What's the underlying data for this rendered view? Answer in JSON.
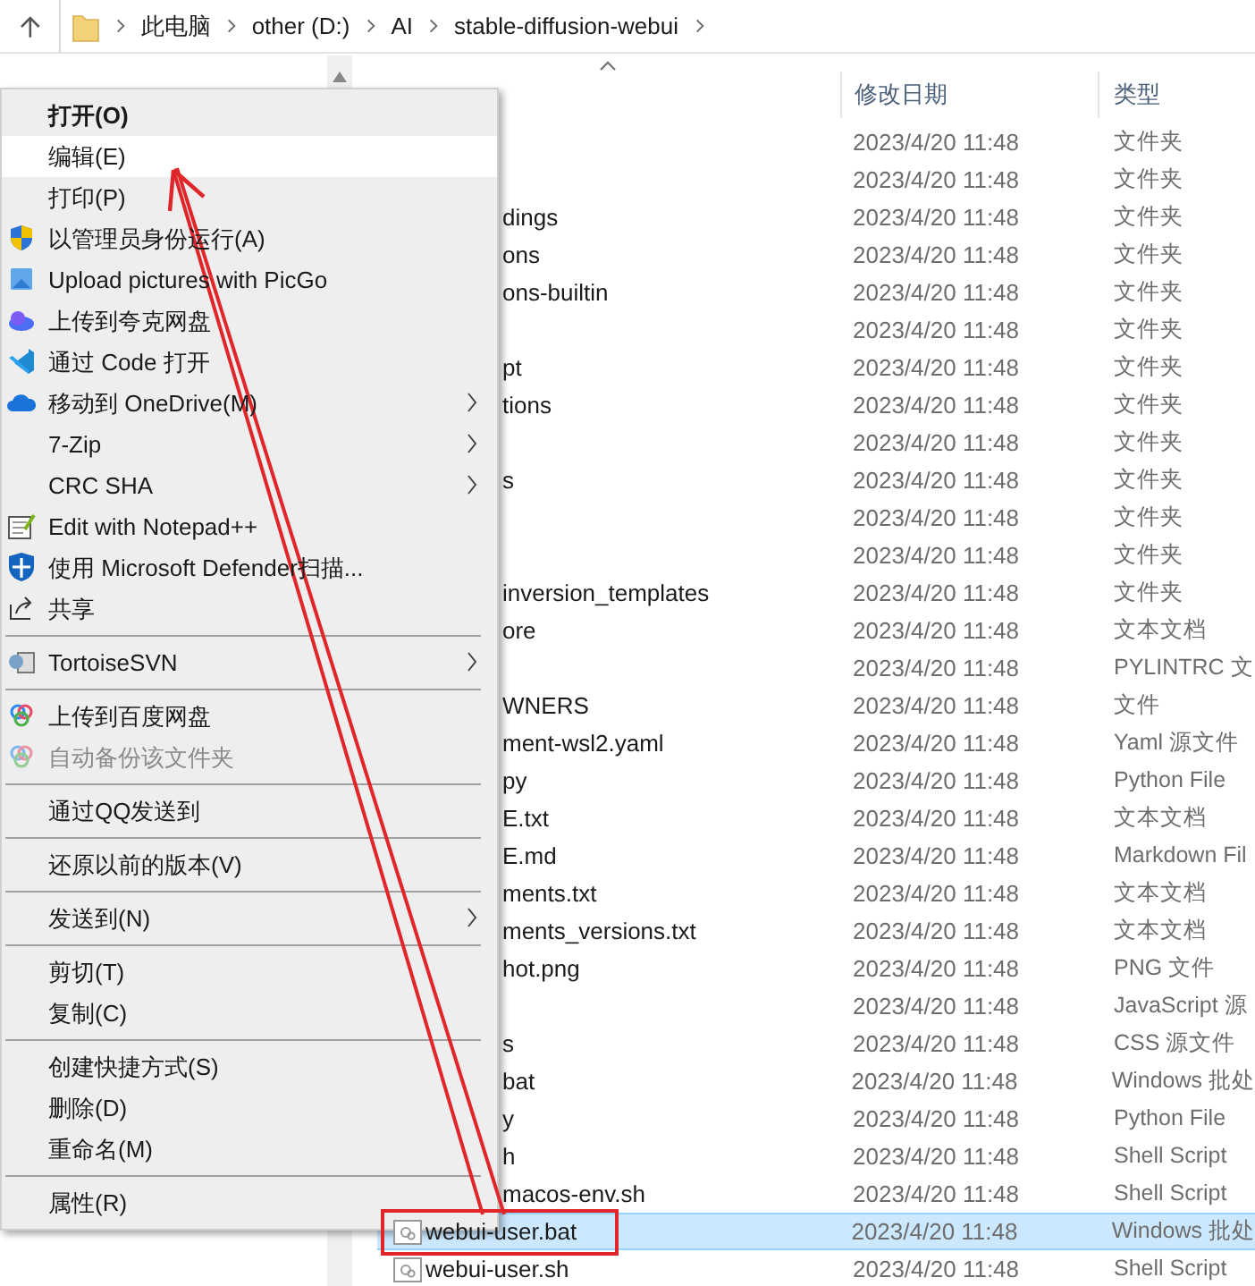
{
  "address_bar": {
    "path": [
      "此电脑",
      "other (D:)",
      "AI",
      "stable-diffusion-webui"
    ]
  },
  "columns": [
    "修改日期",
    "类型"
  ],
  "rows": [
    {
      "date": "2023/4/20 11:48",
      "type": "文件夹",
      "selected": false
    },
    {
      "date": "2023/4/20 11:48",
      "type": "文件夹",
      "selected": false
    },
    {
      "name": "dings",
      "date": "2023/4/20 11:48",
      "type": "文件夹",
      "selected": false
    },
    {
      "name": "ons",
      "date": "2023/4/20 11:48",
      "type": "文件夹",
      "selected": false
    },
    {
      "name": "ons-builtin",
      "date": "2023/4/20 11:48",
      "type": "文件夹",
      "selected": false
    },
    {
      "date": "2023/4/20 11:48",
      "type": "文件夹",
      "selected": false
    },
    {
      "name": "pt",
      "date": "2023/4/20 11:48",
      "type": "文件夹",
      "selected": false
    },
    {
      "name": "tions",
      "date": "2023/4/20 11:48",
      "type": "文件夹",
      "selected": false
    },
    {
      "date": "2023/4/20 11:48",
      "type": "文件夹",
      "selected": false
    },
    {
      "name": "s",
      "date": "2023/4/20 11:48",
      "type": "文件夹",
      "selected": false
    },
    {
      "date": "2023/4/20 11:48",
      "type": "文件夹",
      "selected": false
    },
    {
      "date": "2023/4/20 11:48",
      "type": "文件夹",
      "selected": false
    },
    {
      "name": "inversion_templates",
      "date": "2023/4/20 11:48",
      "type": "文件夹",
      "selected": false
    },
    {
      "name": "ore",
      "date": "2023/4/20 11:48",
      "type": "文本文档",
      "selected": false
    },
    {
      "date": "2023/4/20 11:48",
      "type": "PYLINTRC 文",
      "selected": false
    },
    {
      "name": "WNERS",
      "date": "2023/4/20 11:48",
      "type": "文件",
      "selected": false
    },
    {
      "name": "ment-wsl2.yaml",
      "date": "2023/4/20 11:48",
      "type": "Yaml 源文件",
      "selected": false
    },
    {
      "name": "py",
      "date": "2023/4/20 11:48",
      "type": "Python File",
      "selected": false
    },
    {
      "name": "E.txt",
      "date": "2023/4/20 11:48",
      "type": "文本文档",
      "selected": false
    },
    {
      "name": "E.md",
      "date": "2023/4/20 11:48",
      "type": "Markdown Fil",
      "selected": false
    },
    {
      "name": "ments.txt",
      "date": "2023/4/20 11:48",
      "type": "文本文档",
      "selected": false
    },
    {
      "name": "ments_versions.txt",
      "date": "2023/4/20 11:48",
      "type": "文本文档",
      "selected": false
    },
    {
      "name": "hot.png",
      "date": "2023/4/20 11:48",
      "type": "PNG 文件",
      "selected": false
    },
    {
      "date": "2023/4/20 11:48",
      "type": "JavaScript 源",
      "selected": false
    },
    {
      "name": "s",
      "date": "2023/4/20 11:48",
      "type": "CSS 源文件",
      "selected": false
    },
    {
      "name": "bat",
      "date": "2023/4/20 11:48",
      "type": "Windows 批处",
      "selected": false
    },
    {
      "name": "y",
      "date": "2023/4/20 11:48",
      "type": "Python File",
      "selected": false
    },
    {
      "name": "h",
      "date": "2023/4/20 11:48",
      "type": "Shell Script",
      "selected": false
    },
    {
      "name": "macos-env.sh",
      "date": "2023/4/20 11:48",
      "type": "Shell Script",
      "selected": false
    },
    {
      "name": "webui-user.bat",
      "date": "2023/4/20 11:48",
      "type": "Windows 批处",
      "selected": true,
      "full": true
    },
    {
      "name": "webui-user.sh",
      "date": "2023/4/20 11:48",
      "type": "Shell Script",
      "selected": false,
      "full": true
    }
  ],
  "context_menu": [
    {
      "kind": "item",
      "label": "打开(O)",
      "bold": true,
      "selected": false
    },
    {
      "kind": "item",
      "label": "编辑(E)",
      "selected": true
    },
    {
      "kind": "item",
      "label": "打印(P)",
      "selected": false
    },
    {
      "kind": "item",
      "label": "以管理员身份运行(A)",
      "selected": false
    },
    {
      "kind": "item",
      "label": "Upload pictures with PicGo",
      "selected": false
    },
    {
      "kind": "item",
      "label": "上传到夸克网盘",
      "selected": false
    },
    {
      "kind": "item",
      "label": "通过 Code 打开",
      "selected": false
    },
    {
      "kind": "item",
      "label": "移动到 OneDrive(M)",
      "submenu": true,
      "selected": false
    },
    {
      "kind": "item",
      "label": "7-Zip",
      "submenu": true,
      "selected": false
    },
    {
      "kind": "item",
      "label": "CRC SHA",
      "submenu": true,
      "selected": false
    },
    {
      "kind": "item",
      "label": "Edit with Notepad++",
      "selected": false
    },
    {
      "kind": "item",
      "label": "使用 Microsoft Defender扫描...",
      "selected": false
    },
    {
      "kind": "item",
      "label": "共享",
      "selected": false
    },
    {
      "kind": "separator"
    },
    {
      "kind": "item",
      "label": "TortoiseSVN",
      "submenu": true,
      "selected": false
    },
    {
      "kind": "separator"
    },
    {
      "kind": "item",
      "label": "上传到百度网盘",
      "selected": false
    },
    {
      "kind": "item",
      "label": "自动备份该文件夹",
      "disabled": true,
      "selected": false
    },
    {
      "kind": "separator"
    },
    {
      "kind": "item",
      "label": "通过QQ发送到",
      "selected": false
    },
    {
      "kind": "separator"
    },
    {
      "kind": "item",
      "label": "还原以前的版本(V)",
      "selected": false
    },
    {
      "kind": "separator"
    },
    {
      "kind": "item",
      "label": "发送到(N)",
      "submenu": true,
      "selected": false
    },
    {
      "kind": "separator"
    },
    {
      "kind": "item",
      "label": "剪切(T)",
      "selected": false
    },
    {
      "kind": "item",
      "label": "复制(C)",
      "selected": false
    },
    {
      "kind": "separator"
    },
    {
      "kind": "item",
      "label": "创建快捷方式(S)",
      "selected": false
    },
    {
      "kind": "item",
      "label": "删除(D)",
      "selected": false
    },
    {
      "kind": "item",
      "label": "重命名(M)",
      "selected": false
    },
    {
      "kind": "separator"
    },
    {
      "kind": "item",
      "label": "属性(R)",
      "selected": false
    }
  ]
}
